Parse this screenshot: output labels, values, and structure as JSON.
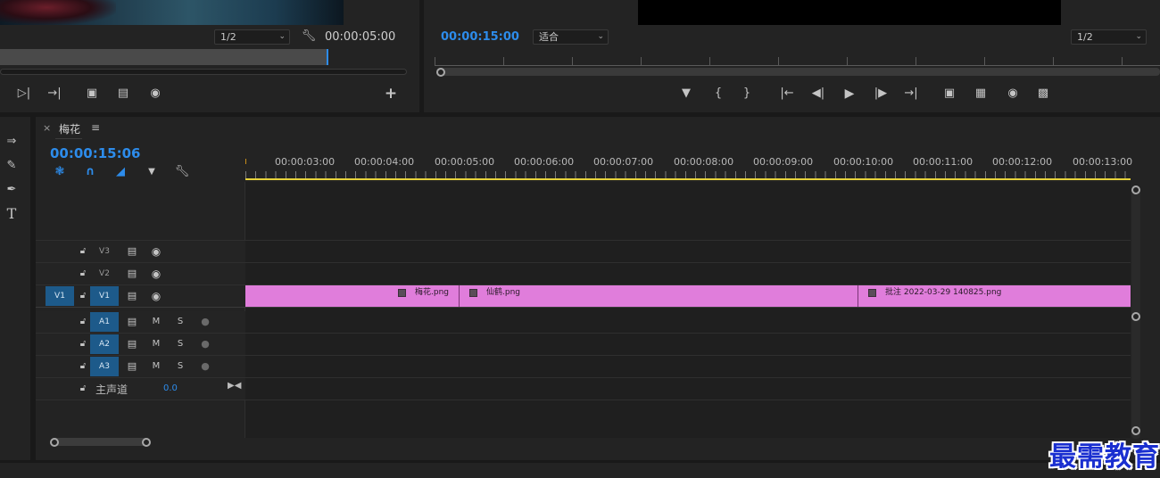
{
  "source_monitor": {
    "resolution": "1/2",
    "timecode": "00:00:05:00",
    "controls": [
      "step-forward-icon",
      "go-to-out-icon",
      "insert-icon",
      "overwrite-icon",
      "export-frame-icon",
      "add-button-icon"
    ]
  },
  "program_monitor": {
    "timecode": "00:00:15:00",
    "fit": "适合",
    "resolution": "1/2",
    "controls": [
      "add-marker-icon",
      "mark-in-icon",
      "mark-out-icon",
      "go-to-in-icon",
      "step-back-icon",
      "play-icon",
      "step-forward-icon",
      "go-to-out-icon",
      "lift-icon",
      "extract-icon",
      "export-frame-icon",
      "compare-icon"
    ]
  },
  "timeline": {
    "sequence_name": "梅花",
    "close": "×",
    "menu": "≡",
    "timecode": "00:00:15:06",
    "ruler": [
      "00:00:03:00",
      "00:00:04:00",
      "00:00:05:00",
      "00:00:06:00",
      "00:00:07:00",
      "00:00:08:00",
      "00:00:09:00",
      "00:00:10:00",
      "00:00:11:00",
      "00:00:12:00",
      "00:00:13:00"
    ],
    "video_tracks": [
      {
        "name": "V3",
        "source": ""
      },
      {
        "name": "V2",
        "source": ""
      },
      {
        "name": "V1",
        "source": "V1"
      }
    ],
    "audio_tracks": [
      {
        "name": "A1",
        "m": "M",
        "s": "S"
      },
      {
        "name": "A2",
        "m": "M",
        "s": "S"
      },
      {
        "name": "A3",
        "m": "M",
        "s": "S"
      }
    ],
    "master": {
      "label": "主声道",
      "value": "0.0"
    },
    "clips": [
      {
        "name": "梅花.png"
      },
      {
        "name": "仙鹤.png"
      },
      {
        "name": "批注 2022-03-29  140825.png"
      }
    ]
  },
  "tools": [
    "track-select-icon",
    "ripple-edit-icon",
    "pen-icon",
    "type-tool-icon"
  ],
  "watermark": "最需教育",
  "colors": {
    "accent": "#2d8ceb",
    "clip": "#e07ddb",
    "playhead_bar": "#e6d23a"
  }
}
